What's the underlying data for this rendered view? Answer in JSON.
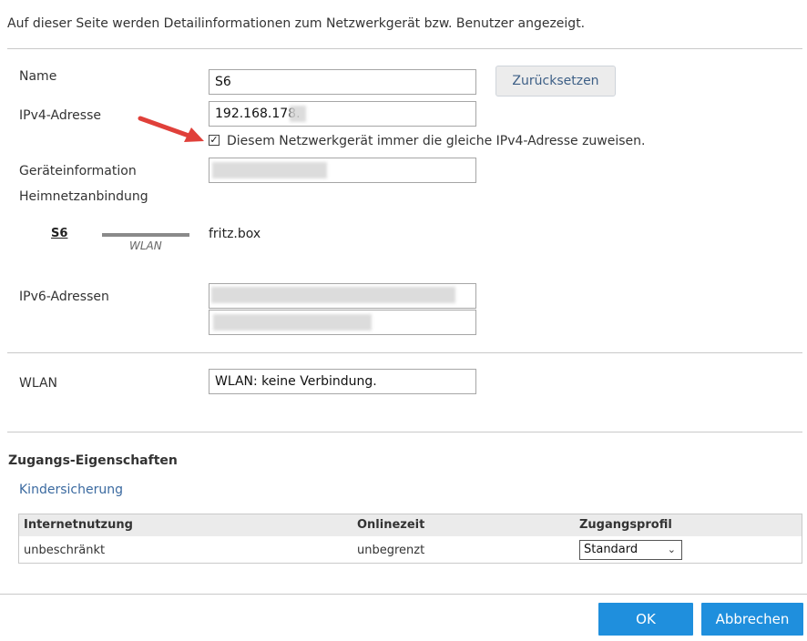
{
  "intro_text": "Auf dieser Seite werden Detailinformationen zum Netzwerkgerät bzw. Benutzer angezeigt.",
  "name": {
    "label": "Name",
    "value": "S6",
    "reset_label": "Zurücksetzen"
  },
  "ipv4": {
    "label": "IPv4-Adresse",
    "value": "192.168.178.",
    "checkbox_label": "Diesem Netzwerkgerät immer die gleiche IPv4-Adresse zuweisen.",
    "checked": true
  },
  "device_info": {
    "label": "Geräteinformation"
  },
  "home_network": {
    "label": "Heimnetzanbindung",
    "device": "S6",
    "connection_type": "WLAN",
    "router": "fritz.box"
  },
  "ipv6": {
    "label": "IPv6-Adressen"
  },
  "wlan": {
    "label": "WLAN",
    "value": "WLAN: keine Verbindung."
  },
  "access": {
    "title": "Zugangs-Eigenschaften",
    "parental_control_link": "Kindersicherung",
    "table": {
      "headers": [
        "Internetnutzung",
        "Onlinezeit",
        "Zugangsprofil"
      ],
      "row": {
        "usage": "unbeschränkt",
        "time": "unbegrenzt",
        "profile": "Standard"
      }
    }
  },
  "footer": {
    "ok_label": "OK",
    "cancel_label": "Abbrechen"
  },
  "colors": {
    "primary_button": "#1f8fdd",
    "link": "#3b6aa0",
    "arrow": "#e0403a"
  }
}
